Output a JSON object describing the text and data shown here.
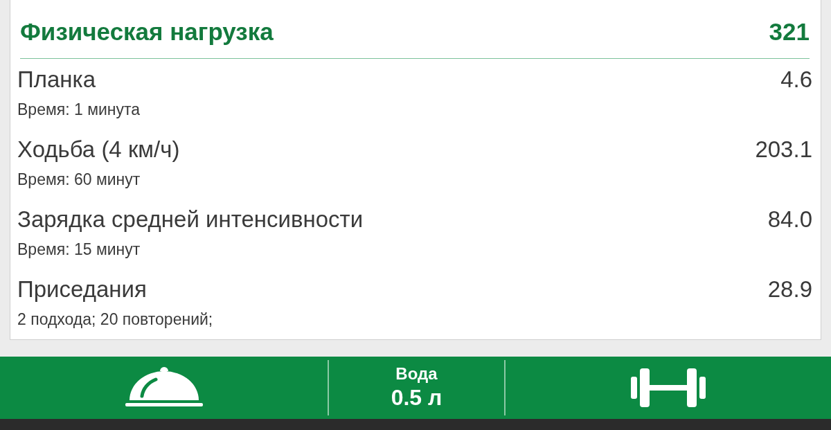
{
  "card": {
    "title": "Физическая нагрузка",
    "total": "321",
    "items": [
      {
        "name": "Планка",
        "detail": "Время: 1 минута",
        "value": "4.6"
      },
      {
        "name": "Ходьба (4 км/ч)",
        "detail": "Время: 60 минут",
        "value": "203.1"
      },
      {
        "name": "Зарядка средней интенсивности",
        "detail": "Время: 15 минут",
        "value": "84.0"
      },
      {
        "name": "Приседания",
        "detail": "2 подхода; 20 повторений;",
        "value": "28.9"
      }
    ]
  },
  "bottom_bar": {
    "water_label": "Вода",
    "water_value": "0.5 л"
  }
}
